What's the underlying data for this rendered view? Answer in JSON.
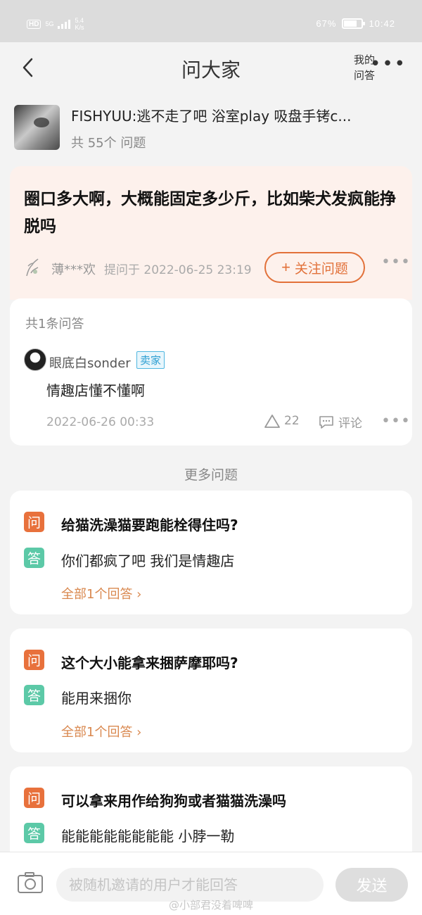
{
  "status_bar": {
    "hd": "HD",
    "network": "5G",
    "speed_value": "5.4",
    "speed_unit": "K/s",
    "battery": "67%",
    "battery_level": 0.67,
    "time": "10:42"
  },
  "nav": {
    "title": "问大家",
    "my_qa_line1": "我的",
    "my_qa_line2": "问答",
    "back_icon": "chevron-left-icon",
    "more_icon": "more-horizontal-icon"
  },
  "product": {
    "name": "FISHYUU:逃不走了吧 浴室play 吸盘手铐c...",
    "question_count": "共 55个 问题"
  },
  "question": {
    "text": "圈口多大啊，大概能固定多少斤，比如柴犬发疯能挣脱吗",
    "asker": "薄***欢",
    "asked_at": "提问于 2022-06-25 23:19",
    "follow_label": "关注问题"
  },
  "answers": {
    "count_label": "共1条问答",
    "items": [
      {
        "user": "眼底白sonder",
        "badge": "卖家",
        "text": "情趣店懂不懂啊",
        "time": "2022-06-26 00:33",
        "likes": "22",
        "comment_label": "评论"
      }
    ]
  },
  "more_questions": {
    "title": "更多问题",
    "q_tag": "问",
    "a_tag": "答",
    "items": [
      {
        "question": "给猫洗澡猫要跑能栓得住吗?",
        "answer": "你们都疯了吧 我们是情趣店",
        "all_answers": "全部1个回答 ›"
      },
      {
        "question": "这个大小能拿来捆萨摩耶吗?",
        "answer": "能用来捆你",
        "all_answers": "全部1个回答 ›"
      },
      {
        "question": "可以拿来用作给狗狗或者猫猫洗澡吗",
        "answer": "能能能能能能能能 小脖一勒",
        "all_answers": ""
      }
    ]
  },
  "bottom": {
    "input_placeholder": "被随机邀请的用户才能回答",
    "send_label": "发送",
    "watermark": "@小部君没着啤啤"
  },
  "colors": {
    "accent": "#e2713a",
    "answer_tag": "#5cc9a7",
    "question_bg": "#fdf1ec",
    "seller_badge": "#2d9fd2"
  }
}
